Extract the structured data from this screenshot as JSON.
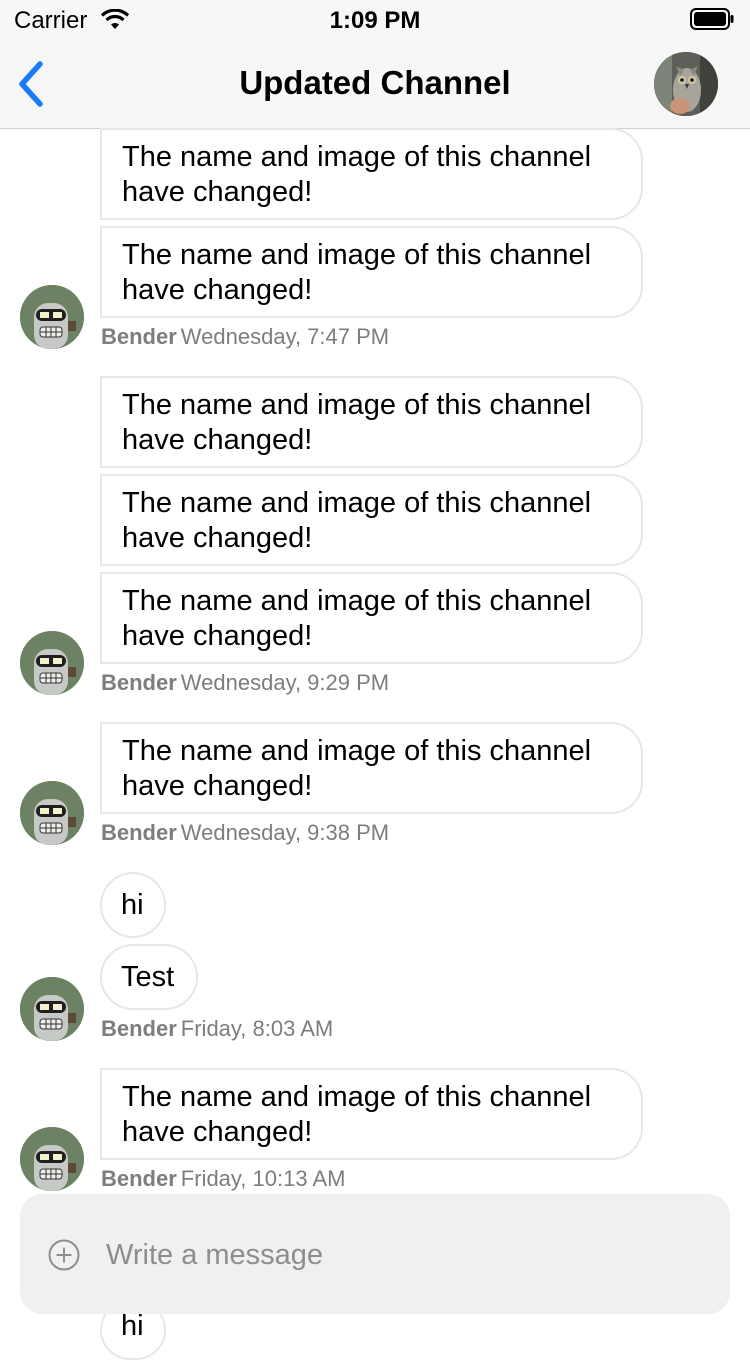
{
  "status": {
    "carrier": "Carrier",
    "time": "1:09 PM"
  },
  "nav": {
    "title": "Updated Channel"
  },
  "messages": {
    "notice": "The name and image of this channel have changed!",
    "hi": "hi",
    "test": "Test"
  },
  "groups": [
    {
      "author": "Bender",
      "timestamp": "Wednesday, 7:47 PM"
    },
    {
      "author": "Bender",
      "timestamp": "Wednesday, 9:29 PM"
    },
    {
      "author": "Bender",
      "timestamp": "Wednesday, 9:38 PM"
    },
    {
      "author": "Bender",
      "timestamp": "Friday, 8:03 AM"
    },
    {
      "author": "Bender",
      "timestamp": "Friday, 10:13 AM"
    }
  ],
  "composer": {
    "placeholder": "Write a message",
    "value": ""
  },
  "colors": {
    "accent": "#1a7cf5",
    "bubble_border": "#e7e7e7",
    "meta": "#7d7d7d"
  }
}
